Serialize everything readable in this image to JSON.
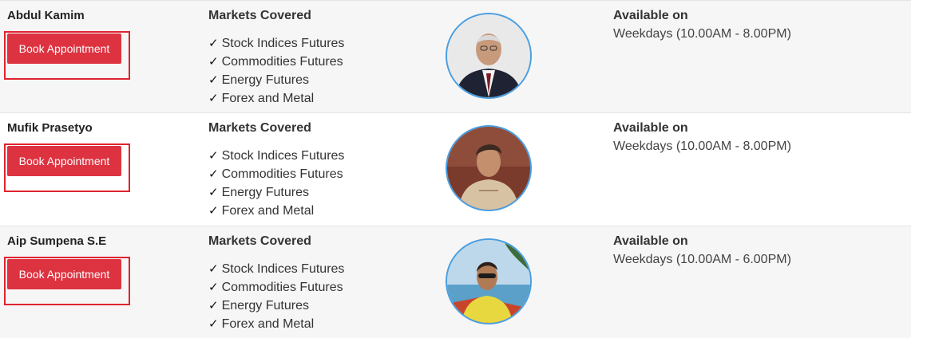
{
  "advisors": [
    {
      "name": "Abdul Kamim",
      "book_label": "Book Appointment",
      "markets_title": "Markets Covered",
      "markets": [
        "Stock Indices Futures",
        "Commodities Futures",
        "Energy Futures",
        "Forex and Metal"
      ],
      "available_title": "Available on",
      "hours": "Weekdays (10.00AM - 8.00PM)",
      "check_glyph": "✓"
    },
    {
      "name": "Mufik Prasetyo",
      "book_label": "Book Appointment",
      "markets_title": "Markets Covered",
      "markets": [
        "Stock Indices Futures",
        "Commodities Futures",
        "Energy Futures",
        "Forex and Metal"
      ],
      "available_title": "Available on",
      "hours": "Weekdays (10.00AM - 8.00PM)",
      "check_glyph": "✓"
    },
    {
      "name": "Aip Sumpena S.E",
      "book_label": "Book Appointment",
      "markets_title": "Markets Covered",
      "markets": [
        "Stock Indices Futures",
        "Commodities Futures",
        "Energy Futures",
        "Forex and Metal"
      ],
      "available_title": "Available on",
      "hours": "Weekdays (10.00AM - 6.00PM)",
      "check_glyph": "✓"
    }
  ],
  "colors": {
    "button": "#dd3341",
    "highlight": "#e0232f",
    "avatar_ring": "#4a9ee0",
    "row_alt": "#f6f6f6"
  }
}
